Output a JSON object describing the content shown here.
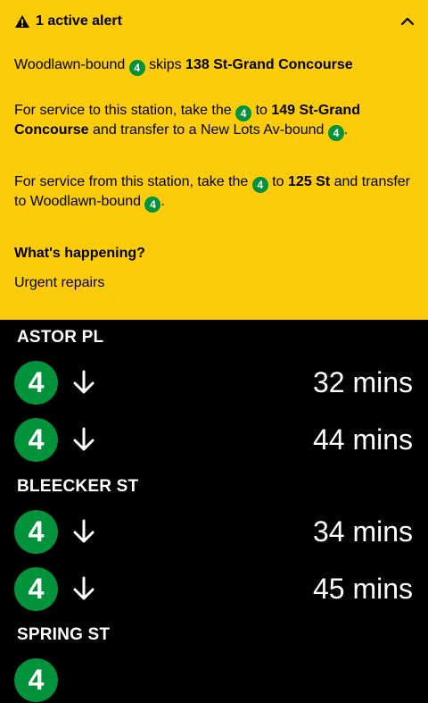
{
  "alert": {
    "title": "1 active alert",
    "icon_warning": "warning-icon",
    "icon_toggle": "chevron-up-icon",
    "line1": {
      "pre": "Woodlawn-bound",
      "route": "4",
      "mid": "skips",
      "station": "138 St-Grand Concourse"
    },
    "line2": {
      "pre": "For service to this station, take the",
      "route": "4",
      "mid": "to",
      "station": "149 St-Grand Concourse",
      "post": "and transfer to a New Lots Av-bound",
      "route2": "4",
      "end": "."
    },
    "line3": {
      "pre": "For service from this station, take the",
      "route": "4",
      "mid": "to",
      "station": "125 St",
      "post": "and transfer to Woodlawn-bound",
      "route2": "4",
      "end": "."
    },
    "heading": "What's happening?",
    "reason": "Urgent repairs"
  },
  "colors": {
    "alert_bg": "#fccc0a",
    "route_4": "#00933c",
    "page_bg": "#000000"
  },
  "stations": [
    {
      "name": "ASTOR PL",
      "arrivals": [
        {
          "route": "4",
          "direction": "down-arrow-icon",
          "time": "32 mins"
        },
        {
          "route": "4",
          "direction": "down-arrow-icon",
          "time": "44 mins"
        }
      ]
    },
    {
      "name": "BLEECKER ST",
      "arrivals": [
        {
          "route": "4",
          "direction": "down-arrow-icon",
          "time": "34 mins"
        },
        {
          "route": "4",
          "direction": "down-arrow-icon",
          "time": "45 mins"
        }
      ]
    },
    {
      "name": "SPRING ST",
      "arrivals": [
        {
          "route": "4"
        }
      ]
    }
  ]
}
